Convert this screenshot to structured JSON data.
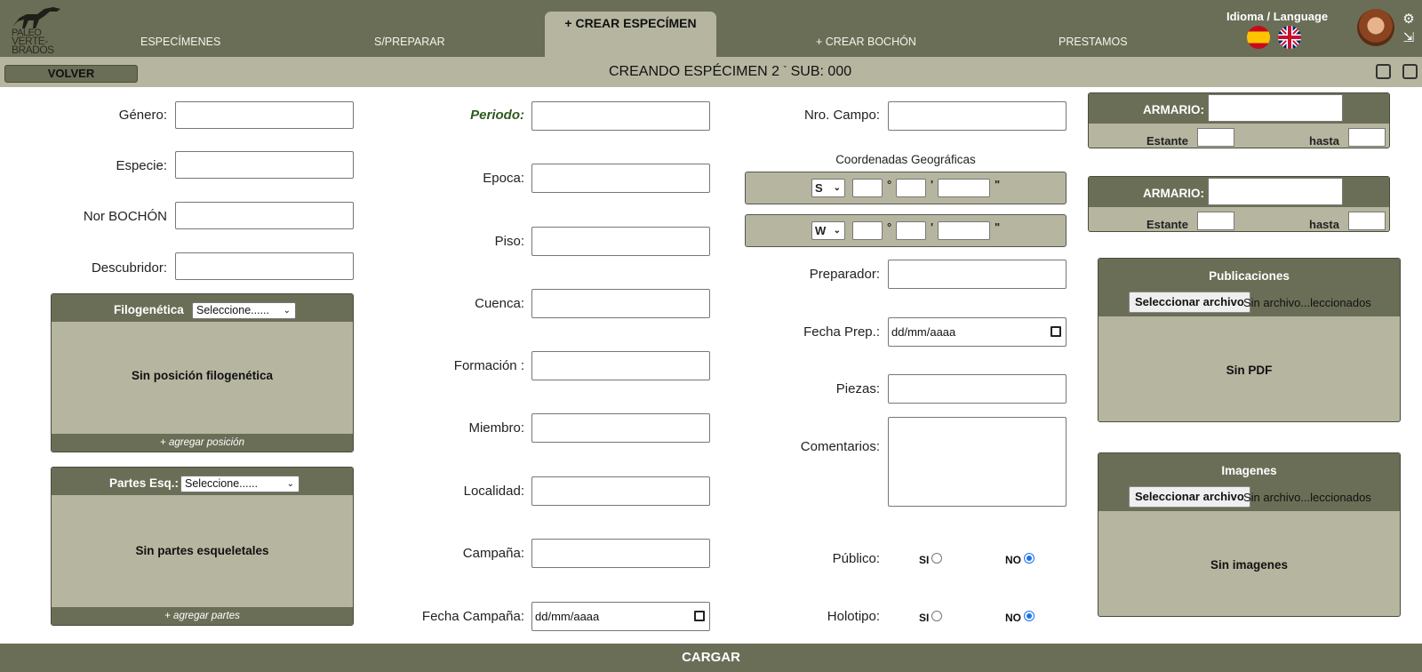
{
  "logo": {
    "line1": "PALEO",
    "line2": "VERTE-",
    "line3": "BRADOS"
  },
  "nav": {
    "tabs": [
      "ESPECÍMENES",
      "S/PREPARAR",
      "+ CREAR ESPECÍMEN",
      "+ CREAR BOCHÓN",
      "PRESTAMOS"
    ],
    "active": "+ CREAR ESPECÍMEN",
    "language_label": "Idioma / Language"
  },
  "subbar": {
    "back_label": "VOLVER",
    "title": "CREANDO ESPÉCIMEN 2",
    "sub": " SUB: 000"
  },
  "col1": {
    "genero": "Género:",
    "especie": "Especie:",
    "bochon": "Nor BOCHÓN",
    "descubridor": "Descubridor:",
    "filo": {
      "title": "Filogenética",
      "select": "Seleccione......",
      "empty": "Sin posición filogenética",
      "add": "+ agregar posición"
    },
    "partes": {
      "title": "Partes Esq.:",
      "select": "Seleccione......",
      "empty": "Sin partes esqueletales",
      "add": "+ agregar partes"
    }
  },
  "col2": {
    "periodo": "Periodo:",
    "epoca": "Epoca:",
    "piso": "Piso:",
    "cuenca": "Cuenca:",
    "formacion": "Formación :",
    "miembro": "Miembro:",
    "localidad": "Localidad:",
    "campana": "Campaña:",
    "fecha_campana": "Fecha Campaña:",
    "date_placeholder": "dd/mm/aaaa"
  },
  "col3": {
    "nro_campo": "Nro. Campo:",
    "coord_title": "Coordenadas Geográficas",
    "lat_dir": "S",
    "lon_dir": "W",
    "deg": "°",
    "min": "'",
    "sec": "\"",
    "preparador": "Preparador:",
    "fecha_prep": "Fecha Prep.:",
    "date_placeholder": "dd/mm/aaaa",
    "piezas": "Piezas:",
    "comentarios": "Comentarios:",
    "publico": "Público:",
    "holotipo": "Holotipo:",
    "si": "SI",
    "no": "NO"
  },
  "col4": {
    "armario": "ARMARIO:",
    "estante": "Estante",
    "hasta": "hasta",
    "publicaciones": {
      "title": "Publicaciones",
      "button": "Seleccionar archivo",
      "file": "Sin archivo...leccionados",
      "empty": "Sin PDF"
    },
    "imagenes": {
      "title": "Imagenes",
      "button": "Seleccionar archivo",
      "file": "Sin archivo...leccionados",
      "empty": "Sin imagenes"
    }
  },
  "footer": {
    "submit": "CARGAR"
  },
  "colors": {
    "header": "#6b6e56",
    "panel": "#b6b6a0",
    "periodo_label": "#2f5a1e",
    "radio_accent": "#1a73e8"
  }
}
